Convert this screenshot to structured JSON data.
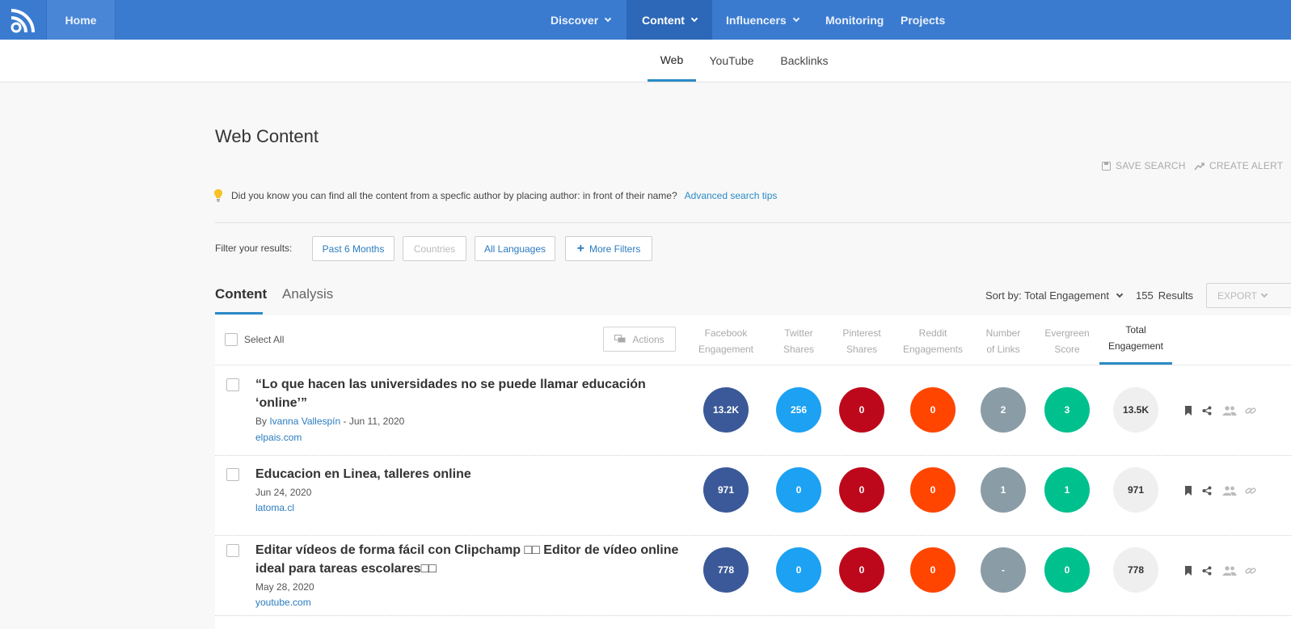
{
  "nav": {
    "home": "Home",
    "items": [
      {
        "label": "Discover",
        "dropdown": true
      },
      {
        "label": "Content",
        "dropdown": true,
        "active": true
      },
      {
        "label": "Influencers",
        "dropdown": true
      },
      {
        "label": "Monitoring",
        "dropdown": false
      },
      {
        "label": "Projects",
        "dropdown": false
      }
    ]
  },
  "subnav": {
    "tabs": [
      "Web",
      "YouTube",
      "Backlinks"
    ],
    "active": "Web"
  },
  "page": {
    "title": "Web Content",
    "save_search": "SAVE SEARCH",
    "create_alert": "CREATE ALERT"
  },
  "tip": {
    "text": "Did you know you can find all the content from a specfic author by placing author: in front of their name?",
    "link": "Advanced search tips"
  },
  "filters": {
    "label": "Filter your results:",
    "buttons": [
      "Past 6 Months",
      "Countries",
      "All Languages",
      "More Filters"
    ]
  },
  "content_tabs": [
    "Content",
    "Analysis"
  ],
  "sort": {
    "label": "Sort by: Total Engagement",
    "results_count": "155",
    "results_label": "Results",
    "export": "EXPORT"
  },
  "table": {
    "select_all": "Select All",
    "actions": "Actions",
    "columns": [
      {
        "line1": "Facebook",
        "line2": "Engagement"
      },
      {
        "line1": "Twitter",
        "line2": "Shares"
      },
      {
        "line1": "Pinterest",
        "line2": "Shares"
      },
      {
        "line1": "Reddit",
        "line2": "Engagements"
      },
      {
        "line1": "Number",
        "line2": "of Links"
      },
      {
        "line1": "Evergreen",
        "line2": "Score"
      },
      {
        "line1": "Total",
        "line2": "Engagement"
      }
    ],
    "rows": [
      {
        "title": "“Lo que hacen las universidades no se puede llamar educación ‘online’”",
        "by": "By ",
        "author": "Ivanna Vallespín",
        "date": " - Jun 11, 2020",
        "domain": "elpais.com",
        "values": [
          "13.2K",
          "256",
          "0",
          "0",
          "2",
          "3",
          "13.5K"
        ]
      },
      {
        "title": "Educacion en Linea, talleres online",
        "by": "",
        "author": "",
        "date": "Jun 24, 2020",
        "domain": "latoma.cl",
        "values": [
          "971",
          "0",
          "0",
          "0",
          "1",
          "1",
          "971"
        ]
      },
      {
        "title": "Editar vídeos de forma fácil con Clipchamp □□ Editor de vídeo online ideal para tareas escolares□□",
        "by": "",
        "author": "",
        "date": "May 28, 2020",
        "domain": "youtube.com",
        "values": [
          "778",
          "0",
          "0",
          "0",
          "-",
          "0",
          "778"
        ]
      }
    ]
  },
  "colors": {
    "nav_bg": "#3a7bd0",
    "accent": "#2a8bc7",
    "facebook": "#3b5998",
    "twitter": "#1da1f2",
    "pinterest": "#bd081c",
    "reddit": "#ff4500",
    "links": "#8a9ca6",
    "evergreen": "#00c08e",
    "total": "#efefef"
  },
  "icons": [
    "rss-logo-icon",
    "bulb-icon",
    "save-icon",
    "trend-up-icon",
    "plus-icon",
    "comments-icon",
    "bookmark-icon",
    "share-icon",
    "users-icon",
    "link-icon",
    "chevron-down-icon"
  ]
}
